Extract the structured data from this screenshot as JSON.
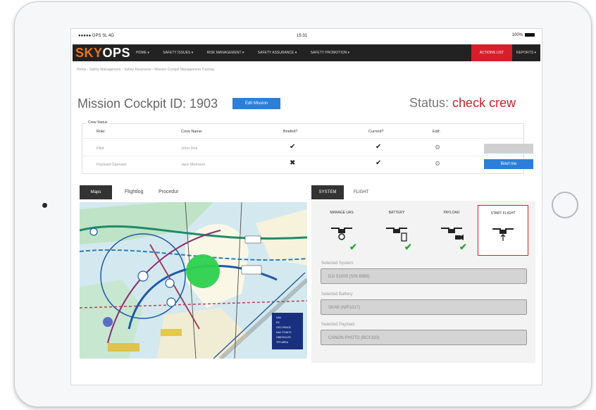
{
  "device": {
    "statusbar": {
      "carrier": "●●●●● GPS SL 4G",
      "time": "15:31",
      "battery": "100%"
    }
  },
  "nav": {
    "logo_sky": "SKY",
    "logo_ops": "OPS",
    "items": [
      "HOME ▾",
      "SAFETY ISSUES ▾",
      "RISK MANAGEMENT ▾",
      "SAFETY ASSURANCE ▾",
      "SAFETY PROMOTION ▾"
    ],
    "red_button": "ACTIONS LIST",
    "reports": "REPORTS ▾"
  },
  "breadcrumb": "Home › Safety Management › Safety Assurance › Mission Cockpit Management Training",
  "mission": {
    "title": "Mission Cockpit ID: 1903",
    "edit_label": "Edit Mission",
    "status_label": "Status:",
    "status_value": "check crew"
  },
  "crew": {
    "legend": "Crew Status",
    "headers": {
      "role": "Role:",
      "name": "Crew Name:",
      "briefed": "Briefed?",
      "current": "Current?",
      "edit": "Edit:"
    },
    "rows": [
      {
        "role": "Pilot",
        "name": "John Doe",
        "briefed": "✔",
        "current": "✔",
        "edit": "⚙"
      },
      {
        "role": "Payload Operator",
        "name": "Jack Morrison",
        "briefed": "✖",
        "current": "✔",
        "edit": "⚙",
        "action": "Brief me"
      }
    ]
  },
  "left_tabs": [
    "Maps",
    "Flightlog",
    "Procedur"
  ],
  "right_tabs": [
    "SYSTEM",
    "FLIGHT"
  ],
  "map_legend": [
    "UAV",
    "RX",
    "GEO-FENCE",
    "NAV. POINTS",
    "OBSTACLES",
    "TFR AREA"
  ],
  "system": {
    "cards": [
      {
        "title": "MANAGE UAS",
        "check": "✔"
      },
      {
        "title": "BATTERY",
        "check": "✔"
      },
      {
        "title": "PAYLOAD",
        "check": "✔"
      },
      {
        "title": "START FLIGHT"
      }
    ],
    "fields": [
      {
        "label": "Selected System:",
        "value": "DJI S1000 (S/N 8989)"
      },
      {
        "label": "Selected Battery:",
        "value": "SKAB (N/P1017)"
      },
      {
        "label": "Selected Payload:",
        "value": "CANON PHOTO (BCX333)"
      }
    ]
  },
  "colors": {
    "accent_blue": "#2b7fd8",
    "alert_red": "#c9232b",
    "brand_orange": "#e8731e",
    "ok_green": "#2aa52e"
  }
}
